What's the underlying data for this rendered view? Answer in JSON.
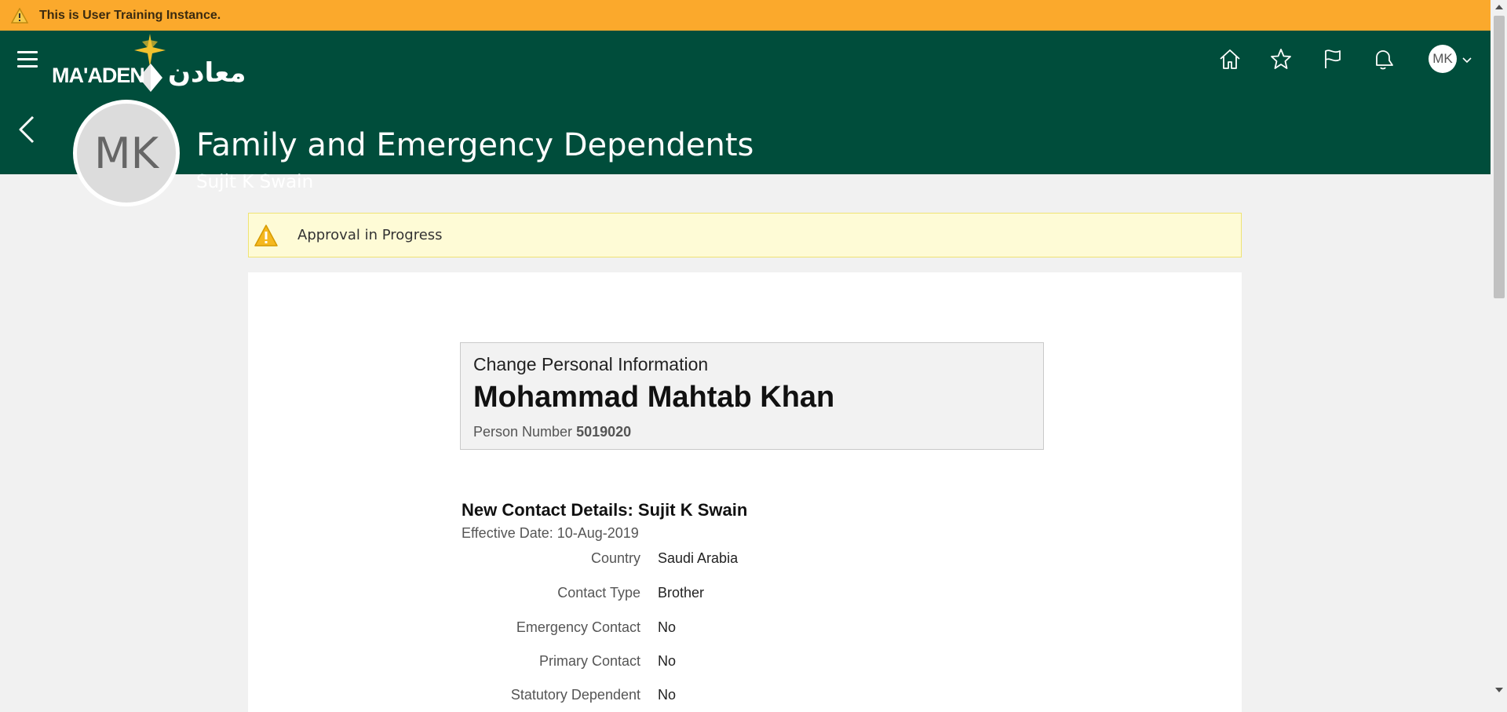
{
  "banner": {
    "text": "This is User Training Instance.",
    "icon": "warning-icon"
  },
  "header": {
    "logo_latin": "MA'ADEN",
    "logo_arabic": "معادن",
    "icons": [
      "home-icon",
      "star-icon",
      "flag-icon",
      "bell-icon"
    ],
    "user_initials": "MK",
    "page_title": "Family and Emergency Dependents",
    "page_subtitle": "Sujit K Swain",
    "avatar_initials": "MK"
  },
  "notice": {
    "text": "Approval in Progress",
    "icon": "warning-icon"
  },
  "infobox": {
    "caption": "Change Personal Information",
    "name": "Mohammad Mahtab Khan",
    "person_number_label": "Person Number",
    "person_number": "5019020"
  },
  "details": {
    "heading": "New Contact Details: Sujit K Swain",
    "effective_date": "Effective Date: 10-Aug-2019",
    "rows": [
      {
        "label": "Country",
        "value": "Saudi Arabia"
      },
      {
        "label": "Contact Type",
        "value": "Brother"
      },
      {
        "label": "Emergency Contact",
        "value": "No"
      },
      {
        "label": "Primary Contact",
        "value": "No"
      },
      {
        "label": "Statutory Dependent",
        "value": "No"
      }
    ]
  },
  "colors": {
    "banner": "#fba92c",
    "header": "#004d3b",
    "notice_bg": "#fefbd6",
    "accent_gold": "#f2c12e"
  }
}
